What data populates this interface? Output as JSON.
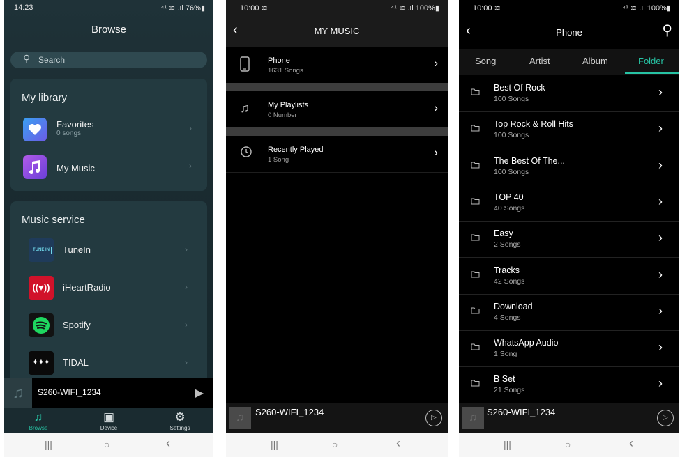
{
  "left": {
    "status": {
      "time": "14:23",
      "icons": "⁴¹ ≋ .ıl 76%▮"
    },
    "title": "Browse",
    "search": {
      "icon": "search-icon",
      "placeholder": "Search"
    },
    "library": {
      "heading": "My library",
      "items": [
        {
          "label": "Favorites",
          "sub": "0 songs",
          "icon": "heart-icon",
          "color": "#5b73e8"
        },
        {
          "label": "My Music",
          "sub": "",
          "icon": "music-note-icon",
          "color": "#8a48e0"
        }
      ]
    },
    "services": {
      "heading": "Music service",
      "items": [
        {
          "label": "TuneIn",
          "badge": "TUNE IN",
          "color": "#1f3b5a"
        },
        {
          "label": "iHeartRadio",
          "badge": "((♥))",
          "color": "#d1122a"
        },
        {
          "label": "Spotify",
          "badge": "≋",
          "color": "#121212"
        },
        {
          "label": "TIDAL",
          "badge": "✦✦✦",
          "color": "#0a0a0a"
        }
      ]
    },
    "player": {
      "name": "S260-WIFI_1234"
    },
    "tabs": [
      {
        "label": "Browse",
        "icon": "music-note-icon"
      },
      {
        "label": "Device",
        "icon": "speaker-icon"
      },
      {
        "label": "Settings",
        "icon": "gear-icon"
      }
    ]
  },
  "middle": {
    "status": {
      "time": "10:00 ≋",
      "icons": "⁴¹ ≋ .ıl 100%▮"
    },
    "title": "MY MUSIC",
    "items": [
      {
        "label": "Phone",
        "sub": "1631 Songs",
        "icon": "phone-icon"
      },
      {
        "label": "My Playlists",
        "sub": "0 Number",
        "icon": "playlist-icon"
      },
      {
        "label": "Recently Played",
        "sub": "1 Song",
        "icon": "clock-icon"
      }
    ],
    "player": {
      "name": "S260-WIFI_1234"
    }
  },
  "right": {
    "status": {
      "time": "10:00 ≋",
      "icons": "⁴¹ ≋ .ıl 100%▮"
    },
    "title": "Phone",
    "tabs": [
      "Song",
      "Artist",
      "Album",
      "Folder"
    ],
    "active_tab": "Folder",
    "folders": [
      {
        "name": "Best Of Rock",
        "count": "100 Songs"
      },
      {
        "name": "Top Rock & Roll Hits",
        "count": "100 Songs"
      },
      {
        "name": "The Best Of The...",
        "count": "100 Songs"
      },
      {
        "name": "TOP 40",
        "count": "40 Songs"
      },
      {
        "name": "Easy",
        "count": "2 Songs"
      },
      {
        "name": "Tracks",
        "count": "42 Songs"
      },
      {
        "name": "Download",
        "count": "4 Songs"
      },
      {
        "name": "WhatsApp Audio",
        "count": "1 Song"
      },
      {
        "name": "B Set",
        "count": "21 Songs"
      }
    ],
    "player": {
      "name": "S260-WIFI_1234"
    }
  },
  "system_nav": {
    "recents": "|||",
    "home": "○",
    "back": "‹"
  },
  "colors": {
    "accent": "#27c3a4",
    "left_bg": "#1d3035"
  }
}
